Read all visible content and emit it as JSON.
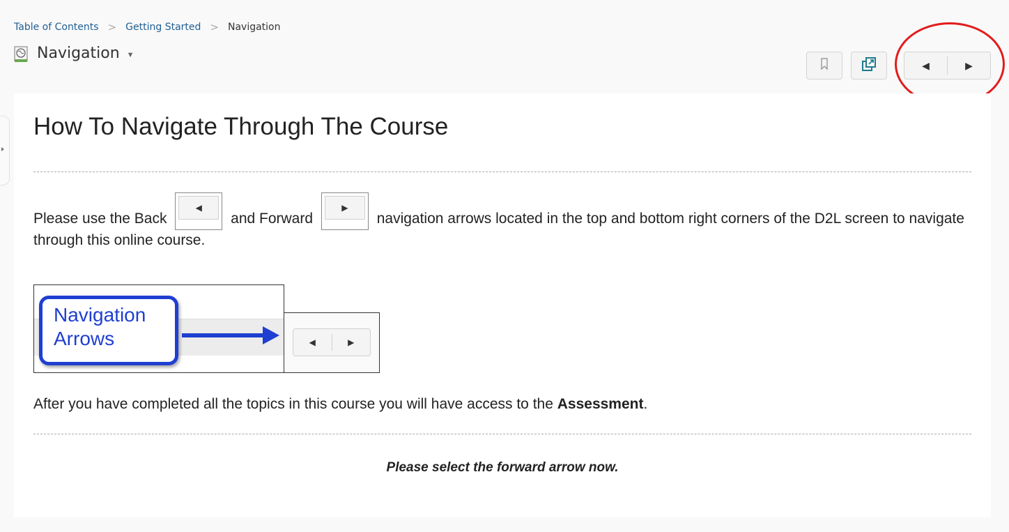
{
  "breadcrumb": {
    "items": [
      "Table of Contents",
      "Getting Started",
      "Navigation"
    ]
  },
  "header": {
    "title": "Navigation"
  },
  "toolbar": {
    "icons": [
      "bookmark-icon",
      "new-window-icon"
    ],
    "prev_icon": "◀",
    "next_icon": "▶"
  },
  "content": {
    "heading": "How To Navigate Through The Course",
    "para1_a": "Please use the Back",
    "para1_b": "and Forward",
    "para1_c": "navigation arrows located in the top and bottom right corners of the D2L screen to navigate through this online course.",
    "figure_callout_line1": "Navigation",
    "figure_callout_line2": "Arrows",
    "para2_a": "After you have completed all the topics in this course you will have access to the ",
    "para2_bold": "Assessment",
    "para2_end": ".",
    "instruction": "Please select the forward arrow now."
  },
  "colors": {
    "link": "#1f5f93",
    "highlight_circle": "#e31b1b",
    "callout_blue": "#1f3fd1"
  }
}
